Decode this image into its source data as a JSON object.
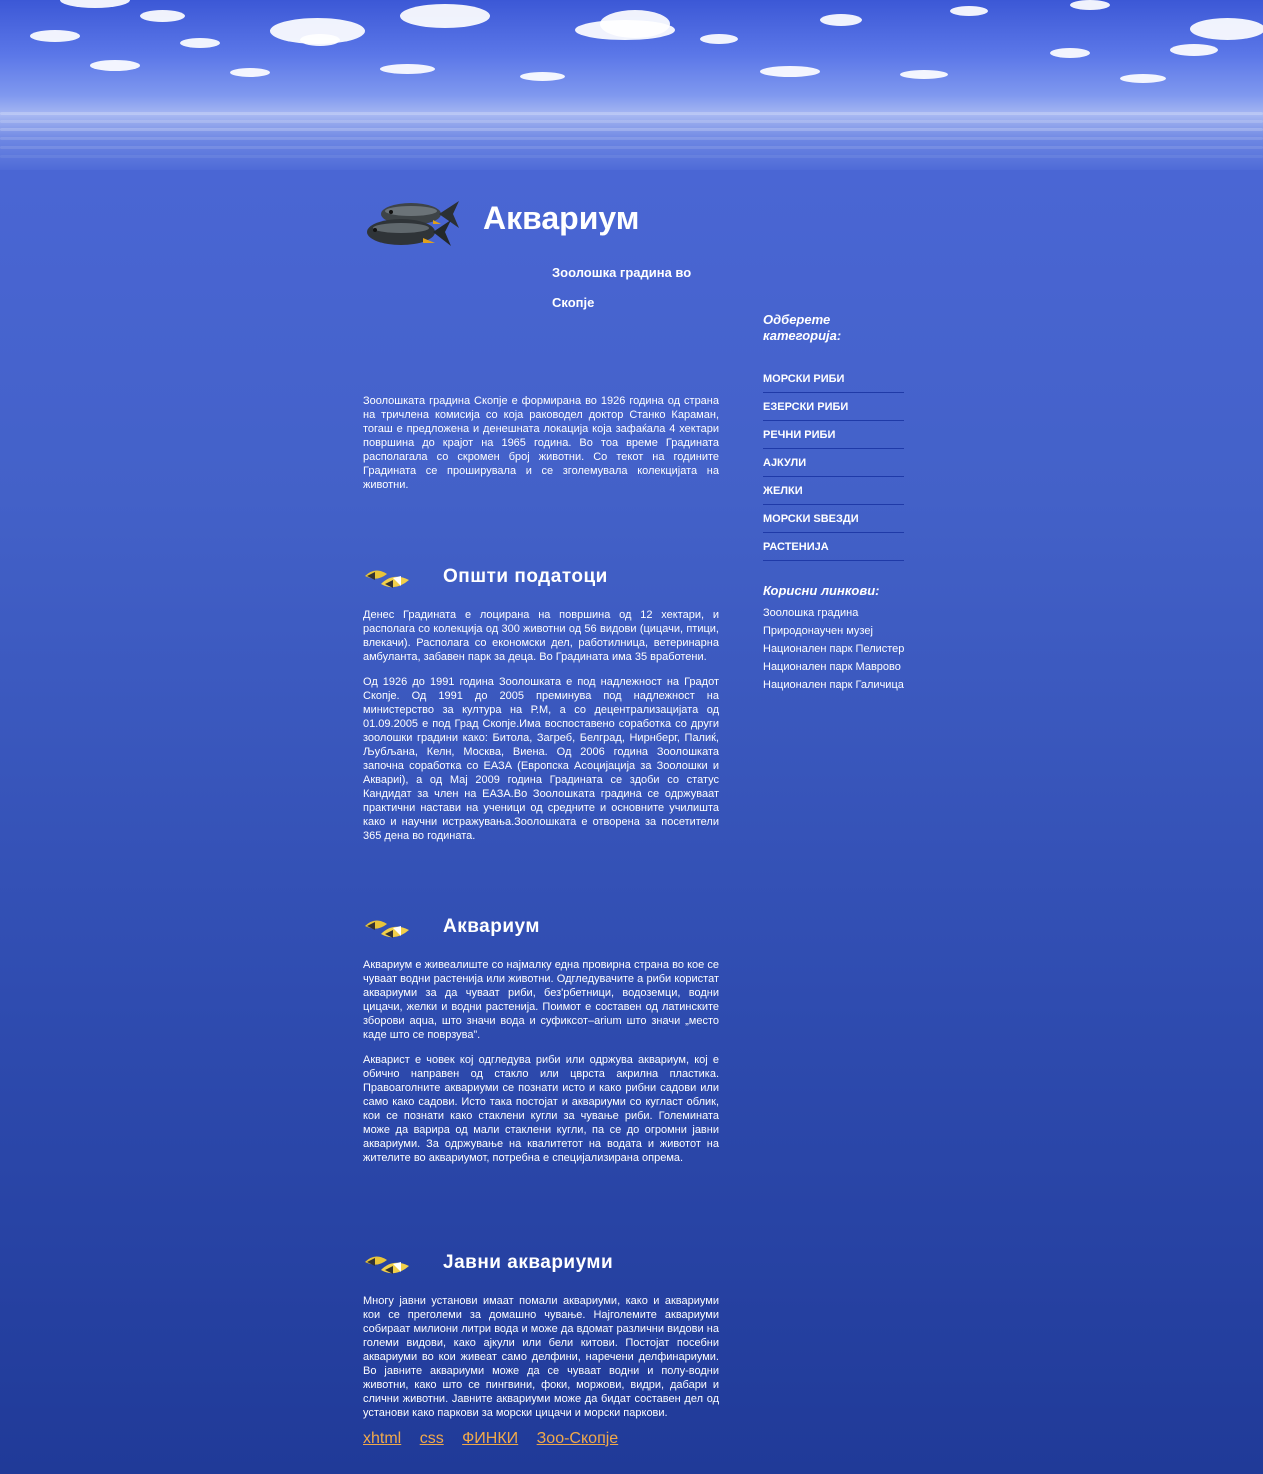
{
  "header": {
    "title": "Аквариум",
    "subtitle": "Зоолошка градина во Скопје"
  },
  "intro": "Зоолошката градина Скопје е формирана во 1926 година од страна на тричлена комисија со која раководел доктор Станко Караман, тогаш е предложена и денешната локација која зафаќала 4 хектари површина до крајот на 1965 година. Во тоа време Градината располагала со скромен број животни. Со текот на годините Градината се проширувала и се зголемувала колекцијата на животни.",
  "sections": [
    {
      "heading": "Општи податоци",
      "paragraphs": [
        "Денес Градината е лоцирана на површина од 12 хектари, и располага со колекција од 300 животни од 56 видови (цицачи, птици, влекачи). Располага со економски дел, работилница, ветеринарна амбуланта, забавен парк за деца. Во Градината има 35 вработени.",
        "Од 1926 до 1991 година Зоолошката е под надлежност на Градот Скопје. Од 1991 до 2005 преминува под надлежност на министерство за култура на Р.М, а со децентрализацијата од 01.09.2005 е под Град Скопје.Има воспоставено соработка со други зоолошки градини како: Битола, Загреб, Белград, Нирнберг, Палиќ, Љубљана, Келн, Москва, Виена. Од 2006 година Зоолошката започна соработка со ЕАЗА (Европска Асоцијација за Зоолошки и Аквариi), а од Мај 2009 година Градината се здоби со статус Кандидат за член на ЕАЗА.Во Зоолошката градина се одржуваат практични настави на ученици од средните и основните училишта како и научни истражувања.Зоолошката е отворена за посетители 365 дена во годината."
      ]
    },
    {
      "heading": "Аквариум",
      "paragraphs": [
        "Аквариум е живеалиште со најмалку една провирна страна во кое се чуваат водни растенија или животни. Одгледувачите а риби користат аквариуми за да чуваат риби, без'рбетници, водоземци, водни цицачи, желки и водни растенија. Поимот е составен од латинските зборови aqua, што значи вода и суфиксот–arium што значи „место каде што се поврзува”.",
        "Акварист е човек кој одгледува риби или одржува аквариум, кој е обично направен од стакло или цврста акрилна пластика. Правоаголните аквариуми се познати исто и како рибни садови или само како садови. Исто така постојат и аквариуми со кугласт облик, кои се познати како стаклени кугли за чување риби. Големината може да варира од мали стаклени кугли, па се до огромни јавни аквариуми. За одржување на квалитетот на водата и животот на жителите во аквариумот, потребна е специјализирана опрема."
      ]
    },
    {
      "heading": "Јавни аквариуми",
      "paragraphs": [
        "Многу јавни установи имаат помали аквариуми, како и аквариуми кои се преголеми за домашно чување. Најголемите аквариуми собираат милиони литри вода и може да вдомат различни видови на големи видови, како ајкули или бели китови. Постојат посебни аквариуми во кои живеат само делфини, наречени делфинариуми. Во јавните аквариуми може да се чуваат водни и полу-водни животни, како што се пингвини, фоки, моржови, видри, дабари и слични животни. Јавните аквариуми може да бидат составен дел од установи како паркови за морски цицачи и морски паркови."
      ]
    }
  ],
  "sidebar": {
    "categories_title": "Одберете категорија:",
    "categories": [
      "МОРСКИ РИБИ",
      "ЕЗЕРСКИ РИБИ",
      "РЕЧНИ РИБИ",
      "АЈКУЛИ",
      "ЖЕЛКИ",
      "МОРСКИ ЅВЕЗДИ",
      "РАСТЕНИЈА"
    ],
    "links_title": "Корисни линкови:",
    "links": [
      "Зоолошка градина",
      "Природонаучен музеј",
      "Национален парк Пелистер",
      "Национален парк Маврово",
      "Национален парк Галичица"
    ]
  },
  "footer": {
    "links": [
      "xhtml",
      "css",
      "ФИНКИ",
      "Зоо-Скопје"
    ]
  },
  "colors": {
    "link": "#f0a94a",
    "divider": "#1f3aa8"
  }
}
